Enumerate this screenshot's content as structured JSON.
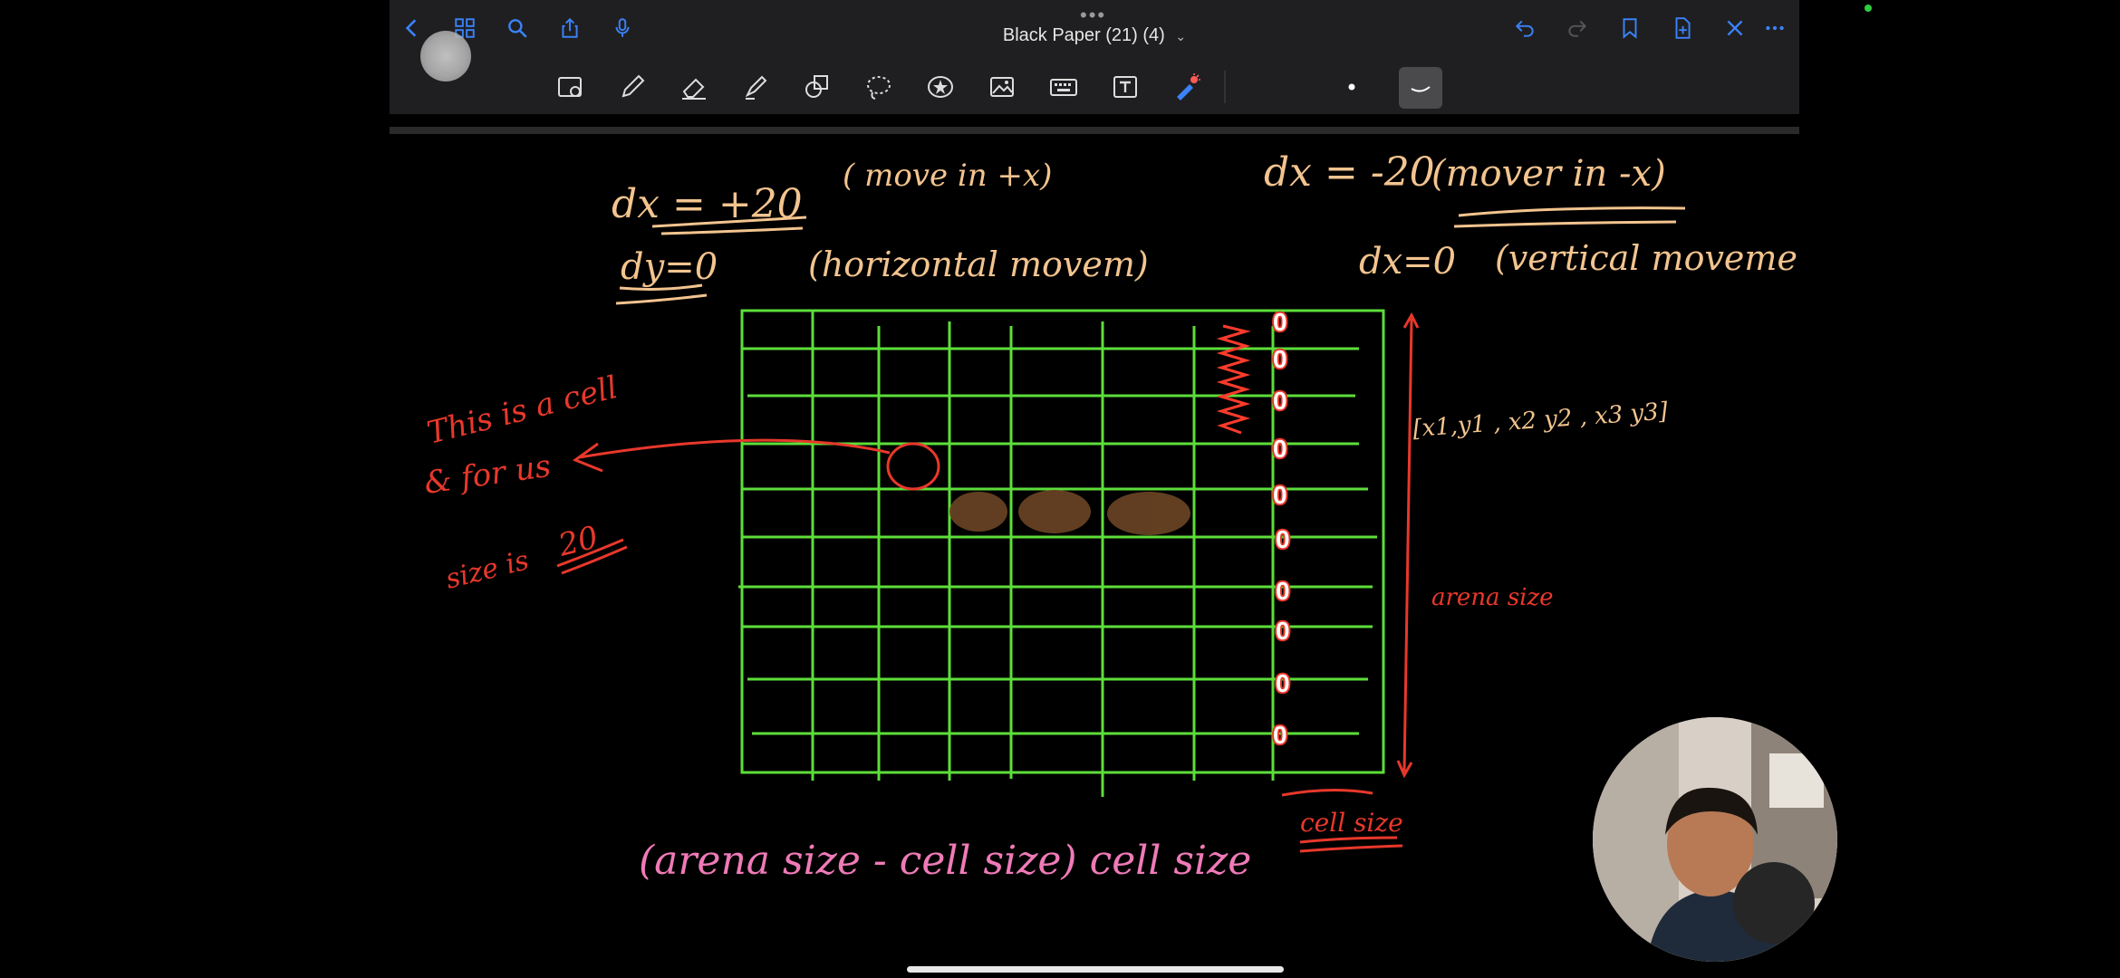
{
  "window": {
    "title": "Black Paper  (21) (4)",
    "title_chevron": "⌄",
    "more_dots": "•••"
  },
  "topbar_left": [
    {
      "name": "back-icon",
      "glyph": "‹"
    },
    {
      "name": "grid-icon",
      "glyph": "▦"
    },
    {
      "name": "search-icon",
      "glyph": "⌕"
    },
    {
      "name": "share-icon",
      "glyph": "⇪"
    },
    {
      "name": "microphone-icon",
      "glyph": "🎙"
    }
  ],
  "topbar_right": [
    {
      "name": "undo-icon",
      "glyph": "↶"
    },
    {
      "name": "redo-icon",
      "glyph": "↷"
    },
    {
      "name": "bookmark-icon",
      "glyph": "🔖"
    },
    {
      "name": "add-page-icon",
      "glyph": "⊞"
    },
    {
      "name": "close-icon",
      "glyph": "✕"
    },
    {
      "name": "more-icon",
      "glyph": "⋯"
    }
  ],
  "tools": [
    "zoom-window-icon",
    "pen-icon",
    "eraser-icon",
    "highlighter-icon",
    "shapes-icon",
    "lasso-icon",
    "sticker-icon",
    "image-icon",
    "keyboard-icon",
    "text-box-icon",
    "laser-pointer-icon"
  ],
  "colors": {
    "accent": "#3b82f6",
    "grid": "#5dde3a",
    "red_ink": "#e8382b",
    "orange_ink": "#f3c48f",
    "pink_ink": "#f07ab8",
    "brown": "#6a4424"
  },
  "notes": {
    "dx_right": "dx = +20",
    "move_right": "( move in +x)",
    "dy_zero": "dy=0",
    "horizontal": "(horizontal movem)",
    "dx_left": "dx = -20",
    "move_left": "(mover in -x)",
    "dx_zero": "dx=0",
    "vertical": "(vertical movement)",
    "cell_line1": "This is a cell",
    "cell_line2": "& for us",
    "cell_line3": "size is",
    "cell_size_value": "20",
    "coords": "[x1,y1 , x2 y2 , x3 y3]",
    "arena_size": "arena size",
    "cell_size": "cell size",
    "formula": "(arena size - cell size) cell size",
    "zeros": [
      "0",
      "0",
      "0",
      "0",
      "0",
      "0",
      "0",
      "0",
      "0",
      "0"
    ]
  }
}
